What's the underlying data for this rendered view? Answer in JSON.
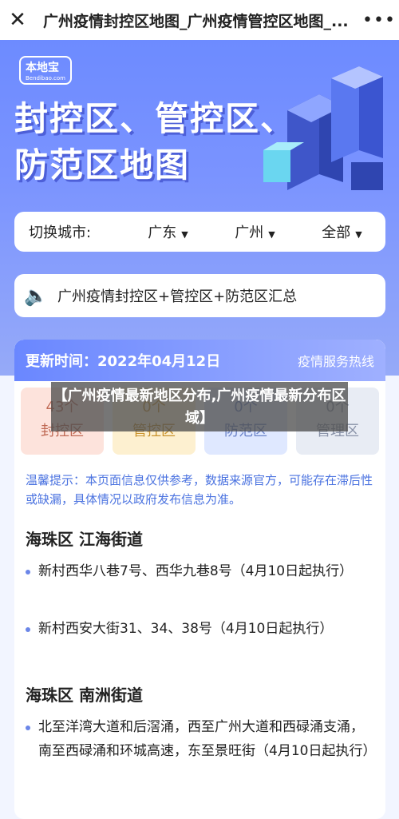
{
  "topbar": {
    "title": "广州疫情封控区地图_广州疫情管控区地图_...",
    "close_icon": "close-icon",
    "more_icon": "more-icon"
  },
  "hero": {
    "logo_main": "本地宝",
    "logo_sub": "Bendibao.com",
    "title_line1": "封控区、管控区、",
    "title_line2": "防范区地图"
  },
  "city_selector": {
    "label": "切换城市:",
    "province": "广东",
    "city": "广州",
    "district": "全部"
  },
  "summary": {
    "text": "广州疫情封控区+管控区+防范区汇总"
  },
  "content": {
    "update_time": "更新时间：2022年04月12日",
    "hotline": "疫情服务热线",
    "stats": [
      {
        "count": "43个",
        "label": "封控区"
      },
      {
        "count": "0个",
        "label": "管控区"
      },
      {
        "count": "0个",
        "label": "防范区"
      },
      {
        "count": "0个",
        "label": "管理区"
      }
    ],
    "tip": "温馨提示：本页面信息仅供参考，数据来源官方，可能存在滞后性或缺漏，具体情况以政府发布信息为准。",
    "sections": [
      {
        "title": "海珠区 江海街道",
        "items": [
          "新村西华八巷7号、西华九巷8号（4月10日起执行）",
          "新村西安大街31、34、38号（4月10日起执行）"
        ]
      },
      {
        "title": "海珠区 南洲街道",
        "items": [
          "北至洋湾大道和后滘涌，西至广州大道和西碌涌支涌，南至西碌涌和环城高速，东至景旺街（4月10日起执行）"
        ]
      }
    ]
  },
  "overlay": {
    "text": "【广州疫情最新地区分布,广州疫情最新分布区域】"
  }
}
